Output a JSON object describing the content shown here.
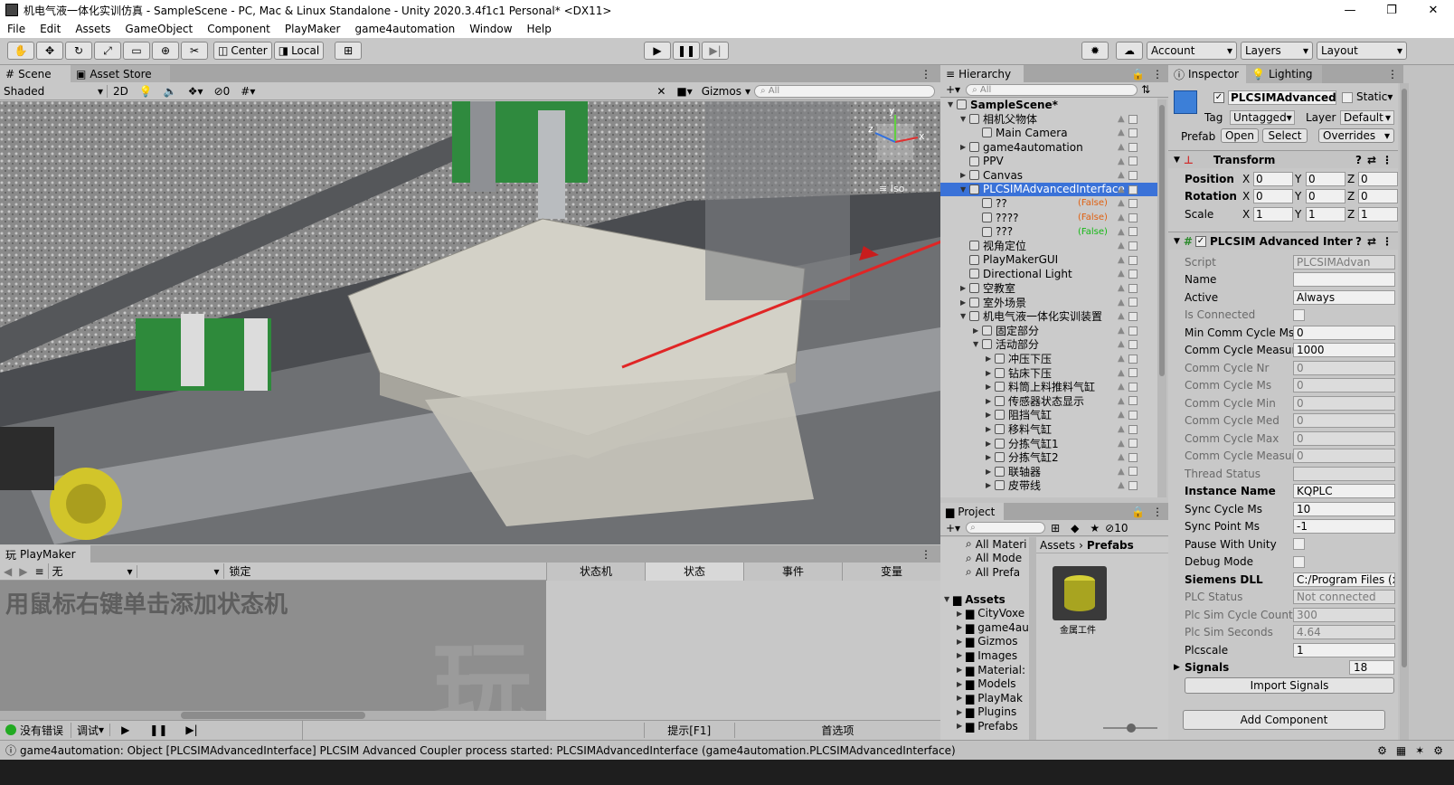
{
  "window": {
    "title": "机电气液一体化实训仿真 - SampleScene - PC, Mac & Linux Standalone - Unity 2020.3.4f1c1 Personal* <DX11>"
  },
  "menu": [
    "File",
    "Edit",
    "Assets",
    "GameObject",
    "Component",
    "PlayMaker",
    "game4automation",
    "Window",
    "Help"
  ],
  "toolbar": {
    "center": "Center",
    "local": "Local",
    "account": "Account",
    "layers": "Layers",
    "layout": "Layout"
  },
  "scene": {
    "tab": "Scene",
    "tab2": "Asset Store",
    "shading": "Shaded",
    "mode2d": "2D",
    "fx_count": "0",
    "gizmos": "Gizmos",
    "search_placeholder": "All",
    "iso": "Iso"
  },
  "hierarchy": {
    "title": "Hierarchy",
    "search_placeholder": "All",
    "items": [
      {
        "label": "SampleScene*",
        "indent": 0
      },
      {
        "label": "相机父物体",
        "indent": 1
      },
      {
        "label": "Main Camera",
        "indent": 2
      },
      {
        "label": "game4automation",
        "indent": 1
      },
      {
        "label": "PPV",
        "indent": 1
      },
      {
        "label": "Canvas",
        "indent": 1
      },
      {
        "label": "PLCSIMAdvancedInterface",
        "indent": 1,
        "selected": true
      },
      {
        "label": "??",
        "indent": 2,
        "flag": "(False)"
      },
      {
        "label": "????",
        "indent": 2,
        "flag": "(False)"
      },
      {
        "label": "???",
        "indent": 2,
        "flag": "(False)",
        "green": true
      },
      {
        "label": "视角定位",
        "indent": 1
      },
      {
        "label": "PlayMakerGUI",
        "indent": 1
      },
      {
        "label": "Directional Light",
        "indent": 1
      },
      {
        "label": "空教室",
        "indent": 1
      },
      {
        "label": "室外场景",
        "indent": 1
      },
      {
        "label": "机电气液一体化实训装置",
        "indent": 1
      },
      {
        "label": "固定部分",
        "indent": 2
      },
      {
        "label": "活动部分",
        "indent": 2
      },
      {
        "label": "冲压下压",
        "indent": 3
      },
      {
        "label": "钻床下压",
        "indent": 3
      },
      {
        "label": "料筒上料推料气缸",
        "indent": 3
      },
      {
        "label": "传感器状态显示",
        "indent": 3
      },
      {
        "label": "阻挡气缸",
        "indent": 3
      },
      {
        "label": "移料气缸",
        "indent": 3
      },
      {
        "label": "分拣气缸1",
        "indent": 3
      },
      {
        "label": "分拣气缸2",
        "indent": 3
      },
      {
        "label": "联轴器",
        "indent": 3
      },
      {
        "label": "皮带线",
        "indent": 3
      }
    ]
  },
  "inspector": {
    "tab": "Inspector",
    "tab2": "Lighting",
    "object_name": "PLCSIMAdvancedInt",
    "static": "Static",
    "tag_label": "Tag",
    "tag": "Untagged",
    "layer_label": "Layer",
    "layer": "Default",
    "prefab_label": "Prefab",
    "open": "Open",
    "select": "Select",
    "overrides": "Overrides",
    "transform": {
      "title": "Transform",
      "position": "Position",
      "rotation": "Rotation",
      "scale": "Scale",
      "pos": [
        "0",
        "0",
        "0"
      ],
      "rot": [
        "0",
        "0",
        "0"
      ],
      "scl": [
        "1",
        "1",
        "1"
      ],
      "x": "X",
      "y": "Y",
      "z": "Z"
    },
    "component_title": "PLCSIM Advanced Inter",
    "fields": [
      {
        "label": "Script",
        "value": "PLCSIMAdvan",
        "dis": true
      },
      {
        "label": "Name",
        "value": ""
      },
      {
        "label": "Active",
        "value": "Always"
      },
      {
        "label": "Is Connected",
        "check": true,
        "dis": true
      },
      {
        "label": "Min Comm Cycle Ms",
        "value": "0"
      },
      {
        "label": "Comm Cycle Measur",
        "value": "1000"
      },
      {
        "label": "Comm Cycle Nr",
        "value": "0",
        "dis": true
      },
      {
        "label": "Comm Cycle Ms",
        "value": "0",
        "dis": true
      },
      {
        "label": "Comm Cycle Min",
        "value": "0",
        "dis": true
      },
      {
        "label": "Comm Cycle Med",
        "value": "0",
        "dis": true
      },
      {
        "label": "Comm Cycle Max",
        "value": "0",
        "dis": true
      },
      {
        "label": "Comm Cycle Measur",
        "value": "0",
        "dis": true
      },
      {
        "label": "Thread Status",
        "value": "",
        "dis": true
      },
      {
        "label": "Instance Name",
        "value": "KQPLC",
        "bold": true
      },
      {
        "label": "Sync Cycle Ms",
        "value": "10"
      },
      {
        "label": "Sync Point Ms",
        "value": "-1"
      },
      {
        "label": "Pause With Unity",
        "check": true
      },
      {
        "label": "Debug Mode",
        "check": true
      },
      {
        "label": "Siemens DLL",
        "value": "C:/Program Files (x",
        "bold": true
      },
      {
        "label": "PLC Status",
        "value": "Not connected",
        "dis": true
      },
      {
        "label": "Plc Sim Cycle Counte",
        "value": "300",
        "dis": true
      },
      {
        "label": "Plc Sim Seconds",
        "value": "4.64",
        "dis": true
      },
      {
        "label": "Plcscale",
        "value": "1"
      }
    ],
    "signals_label": "Signals",
    "signals_count": "18",
    "import_signals": "Import Signals",
    "add_component": "Add Component"
  },
  "project": {
    "title": "Project",
    "count": "10",
    "favorites": [
      "All Materi",
      "All Mode",
      "All Prefa"
    ],
    "assets_label": "Assets",
    "folders": [
      "CityVoxe",
      "game4au",
      "Gizmos",
      "Images",
      "Material:",
      "Models",
      "PlayMak",
      "Plugins",
      "Prefabs"
    ],
    "breadcrumb": "Assets",
    "breadcrumb2": "Prefabs",
    "asset_name": "金属工件"
  },
  "playmaker": {
    "title": "PlayMaker",
    "none": "无",
    "lock": "锁定",
    "tabs": [
      "状态机",
      "状态",
      "事件",
      "变量"
    ],
    "hint": "用鼠标右键单击添加状态机",
    "no_error": "没有错误",
    "debug": "调试",
    "tip": "提示[F1]",
    "prefs": "首选项"
  },
  "status": {
    "message": "game4automation: Object [PLCSIMAdvancedInterface] PLCSIM Advanced Coupler process started: PLCSIMAdvancedInterface (game4automation.PLCSIMAdvancedInterface)"
  }
}
